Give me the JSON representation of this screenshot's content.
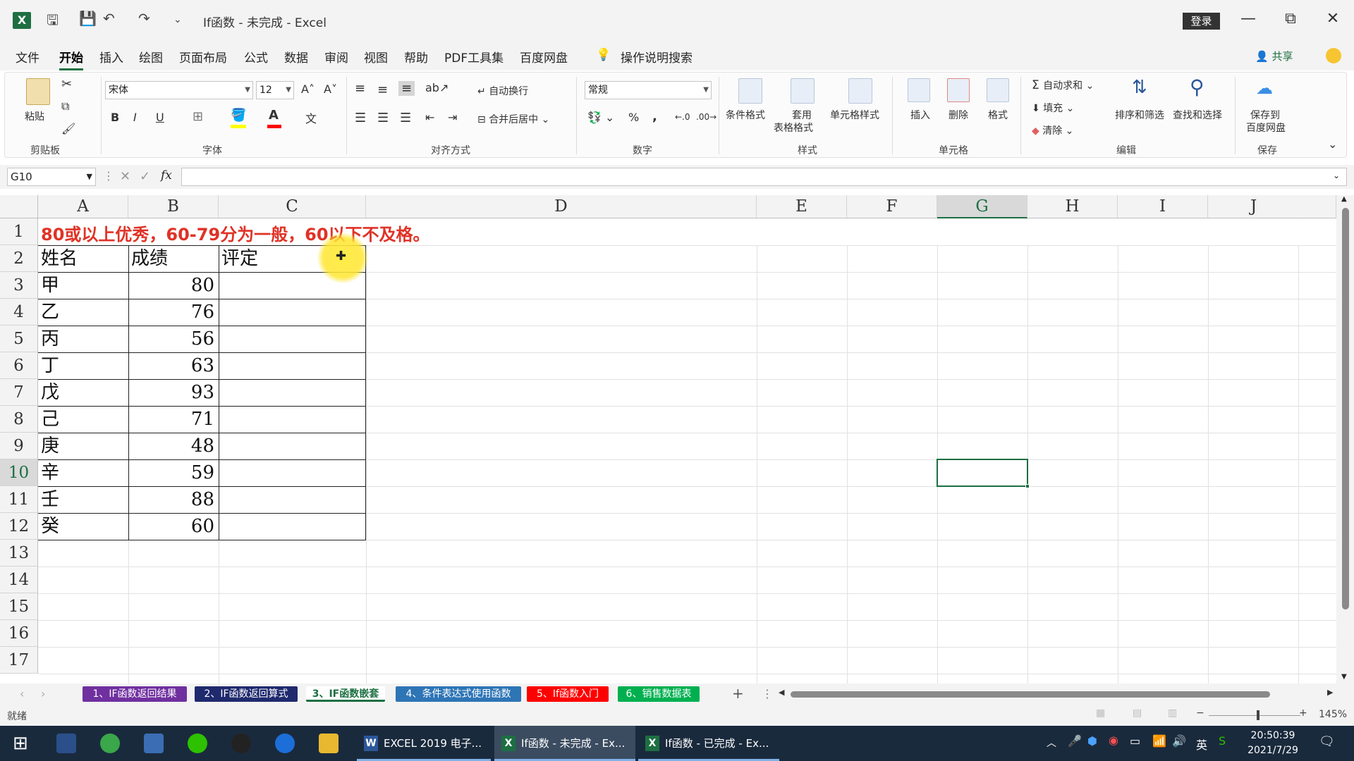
{
  "window": {
    "title": "If函数 - 未完成 - Excel",
    "login": "登录",
    "min": "—",
    "restore": "⧉",
    "close": "✕"
  },
  "menu": {
    "tabs": [
      "文件",
      "开始",
      "插入",
      "绘图",
      "页面布局",
      "公式",
      "数据",
      "审阅",
      "视图",
      "帮助",
      "PDF工具集",
      "百度网盘"
    ],
    "active": "开始",
    "search": "操作说明搜索",
    "share": "共享"
  },
  "ribbon": {
    "clipboard": {
      "label": "剪贴板",
      "paste": "粘贴"
    },
    "font": {
      "label": "字体",
      "name": "宋体",
      "size": "12",
      "bold": "B",
      "italic": "I",
      "underline": "U"
    },
    "alignment": {
      "label": "对齐方式",
      "wrap": "自动换行",
      "merge": "合并后居中"
    },
    "number": {
      "label": "数字",
      "format": "常规",
      "percent": "%",
      "comma": ","
    },
    "styles": {
      "label": "样式",
      "conditional": "条件格式",
      "table_1": "套用",
      "table_2": "表格格式",
      "cell": "单元格样式"
    },
    "cells": {
      "label": "单元格",
      "insert": "插入",
      "delete": "删除",
      "format": "格式"
    },
    "editing": {
      "label": "编辑",
      "autosum": "自动求和",
      "fill": "填充",
      "clear": "清除",
      "sort": "排序和筛选",
      "find": "查找和选择"
    },
    "save": {
      "label": "保存",
      "save_1": "保存到",
      "save_2": "百度网盘"
    }
  },
  "formula_bar": {
    "name_box": "G10",
    "fx": "fx",
    "cancel": "✕",
    "enter": "✓",
    "value": ""
  },
  "grid": {
    "columns": [
      "A",
      "B",
      "C",
      "D",
      "E",
      "F",
      "G",
      "H",
      "I",
      "J"
    ],
    "rows": [
      "1",
      "2",
      "3",
      "4",
      "5",
      "6",
      "7",
      "8",
      "9",
      "10",
      "11",
      "12",
      "13",
      "14",
      "15",
      "16",
      "17"
    ],
    "selected_column": "G",
    "selected_row": "10",
    "title_text": "80或以上优秀，60-79分为一般，60以下不及格。",
    "headers": [
      "姓名",
      "成绩",
      "评定"
    ],
    "table": [
      {
        "name": "甲",
        "score": "80"
      },
      {
        "name": "乙",
        "score": "76"
      },
      {
        "name": "丙",
        "score": "56"
      },
      {
        "name": "丁",
        "score": "63"
      },
      {
        "name": "戊",
        "score": "93"
      },
      {
        "name": "己",
        "score": "71"
      },
      {
        "name": "庚",
        "score": "48"
      },
      {
        "name": "辛",
        "score": "59"
      },
      {
        "name": "壬",
        "score": "88"
      },
      {
        "name": "癸",
        "score": "60"
      }
    ]
  },
  "sheets": [
    {
      "name": "1、IF函数返回结果",
      "color": "#7030a0"
    },
    {
      "name": "2、IF函数返回算式",
      "color": "#1f2a6e"
    },
    {
      "name": "3、IF函数嵌套",
      "color": "#ffffff"
    },
    {
      "name": "4、条件表达式使用函数",
      "color": "#2e75b6"
    },
    {
      "name": "5、If函数入门",
      "color": "#ff0000"
    },
    {
      "name": "6、销售数据表",
      "color": "#00b050"
    }
  ],
  "active_sheet": "3、IF函数嵌套",
  "status": {
    "ready": "就绪",
    "zoom": "145%"
  },
  "taskbar": {
    "apps": [
      {
        "label": "EXCEL 2019 电子...",
        "kind": "word"
      },
      {
        "label": "If函数 - 未完成 - Ex...",
        "kind": "excel"
      },
      {
        "label": "If函数 - 已完成 - Ex...",
        "kind": "excel"
      }
    ],
    "ime": "英",
    "time": "20:50:39",
    "date": "2021/7/29"
  }
}
